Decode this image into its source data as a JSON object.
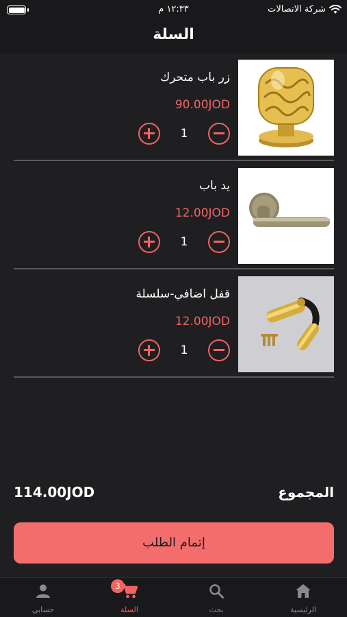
{
  "status_bar": {
    "carrier": "شركة الاتصالات",
    "time": "١٢:٣٣ م"
  },
  "header": {
    "title": "السلة"
  },
  "cart": {
    "items": [
      {
        "name": "زر باب متحرك",
        "price": "90.00JOD",
        "quantity": "1",
        "image": "gold-door-knob"
      },
      {
        "name": "يد باب",
        "price": "12.00JOD",
        "quantity": "1",
        "image": "door-lever-handle"
      },
      {
        "name": "قفل اضافي-سلسلة",
        "price": "12.00JOD",
        "quantity": "1",
        "image": "brass-chain-door-guard"
      }
    ]
  },
  "total": {
    "label": "المجموع",
    "value": "114.00JOD"
  },
  "checkout": {
    "label": "إتمام الطلب"
  },
  "tab_bar": {
    "tabs": [
      {
        "label": "حسابي",
        "icon": "person-icon"
      },
      {
        "label": "السلة",
        "icon": "cart-icon",
        "badge": "3"
      },
      {
        "label": "بحث",
        "icon": "search-icon"
      },
      {
        "label": "الرئيسية",
        "icon": "home-icon"
      }
    ]
  },
  "colors": {
    "accent": "#f26363",
    "background": "#1f1f22",
    "bar": "#19191b",
    "checkout": "#f46d6d"
  }
}
